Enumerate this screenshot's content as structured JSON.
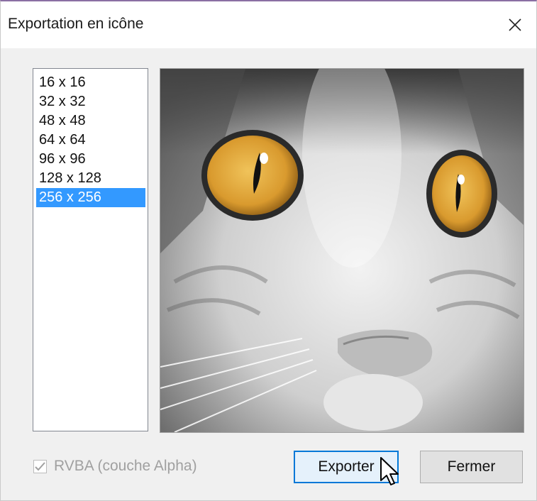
{
  "window": {
    "title": "Exportation en icône",
    "close_icon": "close-x-icon"
  },
  "sizes": {
    "items": [
      "16 x 16",
      "32 x 32",
      "48 x 48",
      "64 x 64",
      "96 x 96",
      "128 x 128",
      "256 x 256"
    ],
    "selected": "256 x 256"
  },
  "preview": {
    "content": "cat-face-photo",
    "eye_color": "#d99a2e"
  },
  "options": {
    "rgba_label": "RVBA (couche Alpha)",
    "rgba_checked": true,
    "rgba_enabled": false
  },
  "buttons": {
    "export_label": "Exporter",
    "close_label": "Fermer"
  },
  "colors": {
    "selection": "#3399ff",
    "focus_border": "#0078d7",
    "title_accent": "#8a6fa3"
  },
  "cursor": "arrow-cursor-icon"
}
